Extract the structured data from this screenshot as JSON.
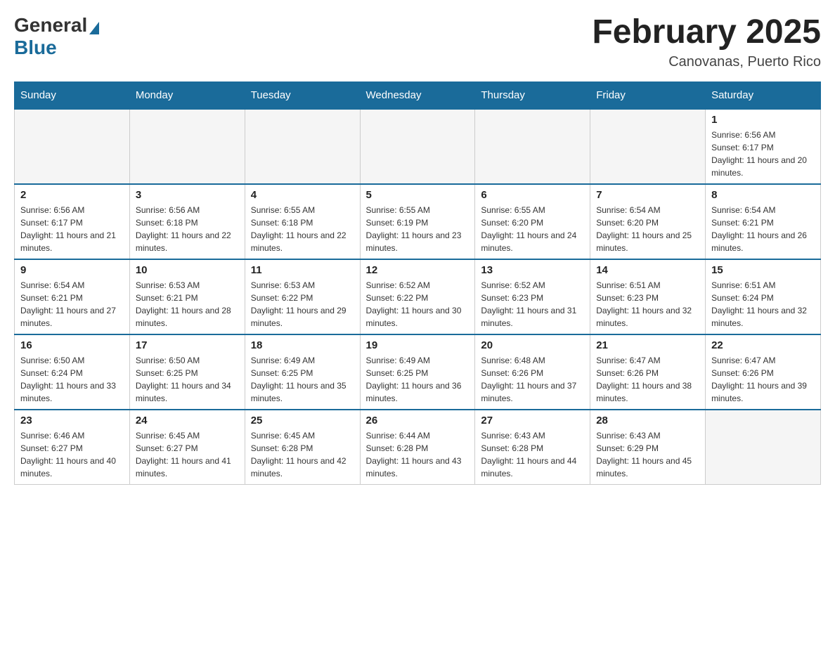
{
  "logo": {
    "general": "General",
    "blue": "Blue"
  },
  "title": "February 2025",
  "subtitle": "Canovanas, Puerto Rico",
  "days_of_week": [
    "Sunday",
    "Monday",
    "Tuesday",
    "Wednesday",
    "Thursday",
    "Friday",
    "Saturday"
  ],
  "weeks": [
    [
      {
        "day": "",
        "info": ""
      },
      {
        "day": "",
        "info": ""
      },
      {
        "day": "",
        "info": ""
      },
      {
        "day": "",
        "info": ""
      },
      {
        "day": "",
        "info": ""
      },
      {
        "day": "",
        "info": ""
      },
      {
        "day": "1",
        "info": "Sunrise: 6:56 AM\nSunset: 6:17 PM\nDaylight: 11 hours and 20 minutes."
      }
    ],
    [
      {
        "day": "2",
        "info": "Sunrise: 6:56 AM\nSunset: 6:17 PM\nDaylight: 11 hours and 21 minutes."
      },
      {
        "day": "3",
        "info": "Sunrise: 6:56 AM\nSunset: 6:18 PM\nDaylight: 11 hours and 22 minutes."
      },
      {
        "day": "4",
        "info": "Sunrise: 6:55 AM\nSunset: 6:18 PM\nDaylight: 11 hours and 22 minutes."
      },
      {
        "day": "5",
        "info": "Sunrise: 6:55 AM\nSunset: 6:19 PM\nDaylight: 11 hours and 23 minutes."
      },
      {
        "day": "6",
        "info": "Sunrise: 6:55 AM\nSunset: 6:20 PM\nDaylight: 11 hours and 24 minutes."
      },
      {
        "day": "7",
        "info": "Sunrise: 6:54 AM\nSunset: 6:20 PM\nDaylight: 11 hours and 25 minutes."
      },
      {
        "day": "8",
        "info": "Sunrise: 6:54 AM\nSunset: 6:21 PM\nDaylight: 11 hours and 26 minutes."
      }
    ],
    [
      {
        "day": "9",
        "info": "Sunrise: 6:54 AM\nSunset: 6:21 PM\nDaylight: 11 hours and 27 minutes."
      },
      {
        "day": "10",
        "info": "Sunrise: 6:53 AM\nSunset: 6:21 PM\nDaylight: 11 hours and 28 minutes."
      },
      {
        "day": "11",
        "info": "Sunrise: 6:53 AM\nSunset: 6:22 PM\nDaylight: 11 hours and 29 minutes."
      },
      {
        "day": "12",
        "info": "Sunrise: 6:52 AM\nSunset: 6:22 PM\nDaylight: 11 hours and 30 minutes."
      },
      {
        "day": "13",
        "info": "Sunrise: 6:52 AM\nSunset: 6:23 PM\nDaylight: 11 hours and 31 minutes."
      },
      {
        "day": "14",
        "info": "Sunrise: 6:51 AM\nSunset: 6:23 PM\nDaylight: 11 hours and 32 minutes."
      },
      {
        "day": "15",
        "info": "Sunrise: 6:51 AM\nSunset: 6:24 PM\nDaylight: 11 hours and 32 minutes."
      }
    ],
    [
      {
        "day": "16",
        "info": "Sunrise: 6:50 AM\nSunset: 6:24 PM\nDaylight: 11 hours and 33 minutes."
      },
      {
        "day": "17",
        "info": "Sunrise: 6:50 AM\nSunset: 6:25 PM\nDaylight: 11 hours and 34 minutes."
      },
      {
        "day": "18",
        "info": "Sunrise: 6:49 AM\nSunset: 6:25 PM\nDaylight: 11 hours and 35 minutes."
      },
      {
        "day": "19",
        "info": "Sunrise: 6:49 AM\nSunset: 6:25 PM\nDaylight: 11 hours and 36 minutes."
      },
      {
        "day": "20",
        "info": "Sunrise: 6:48 AM\nSunset: 6:26 PM\nDaylight: 11 hours and 37 minutes."
      },
      {
        "day": "21",
        "info": "Sunrise: 6:47 AM\nSunset: 6:26 PM\nDaylight: 11 hours and 38 minutes."
      },
      {
        "day": "22",
        "info": "Sunrise: 6:47 AM\nSunset: 6:26 PM\nDaylight: 11 hours and 39 minutes."
      }
    ],
    [
      {
        "day": "23",
        "info": "Sunrise: 6:46 AM\nSunset: 6:27 PM\nDaylight: 11 hours and 40 minutes."
      },
      {
        "day": "24",
        "info": "Sunrise: 6:45 AM\nSunset: 6:27 PM\nDaylight: 11 hours and 41 minutes."
      },
      {
        "day": "25",
        "info": "Sunrise: 6:45 AM\nSunset: 6:28 PM\nDaylight: 11 hours and 42 minutes."
      },
      {
        "day": "26",
        "info": "Sunrise: 6:44 AM\nSunset: 6:28 PM\nDaylight: 11 hours and 43 minutes."
      },
      {
        "day": "27",
        "info": "Sunrise: 6:43 AM\nSunset: 6:28 PM\nDaylight: 11 hours and 44 minutes."
      },
      {
        "day": "28",
        "info": "Sunrise: 6:43 AM\nSunset: 6:29 PM\nDaylight: 11 hours and 45 minutes."
      },
      {
        "day": "",
        "info": ""
      }
    ]
  ]
}
